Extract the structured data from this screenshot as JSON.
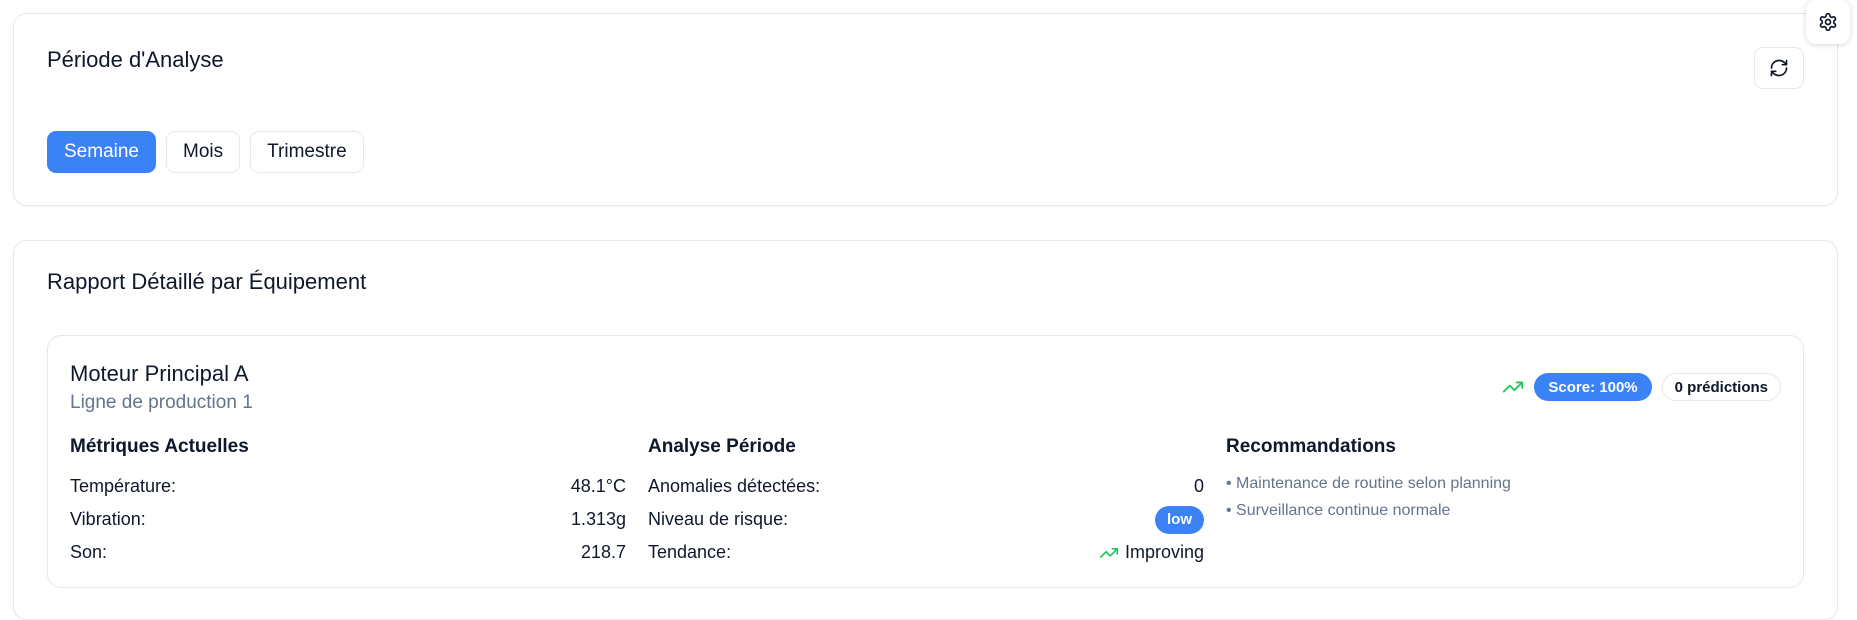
{
  "period": {
    "title": "Période d'Analyse",
    "options": [
      {
        "label": "Semaine",
        "active": true
      },
      {
        "label": "Mois",
        "active": false
      },
      {
        "label": "Trimestre",
        "active": false
      }
    ],
    "refresh_icon": "refresh-icon"
  },
  "report": {
    "title": "Rapport Détaillé par Équipement",
    "equipment": {
      "name": "Moteur Principal A",
      "line": "Ligne de production 1",
      "trend_icon": "trending-up-icon",
      "score": "Score: 100%",
      "predictions": "0 prédictions",
      "metrics": {
        "title": "Métriques Actuelles",
        "rows": [
          {
            "label": "Température:",
            "value": "48.1°C"
          },
          {
            "label": "Vibration:",
            "value": "1.313g"
          },
          {
            "label": "Son:",
            "value": "218.7"
          }
        ]
      },
      "analysis": {
        "title": "Analyse Période",
        "anomalies_label": "Anomalies détectées:",
        "anomalies_value": "0",
        "risk_label": "Niveau de risque:",
        "risk_value": "low",
        "trend_label": "Tendance:",
        "trend_value": "Improving"
      },
      "recommendations": {
        "title": "Recommandations",
        "items": [
          "• Maintenance de routine selon planning",
          "• Surveillance continue normale"
        ]
      }
    }
  },
  "settings_icon": "gear-icon",
  "colors": {
    "accent": "#3b82f6",
    "trend_green": "#22c55e",
    "muted_text": "#64748b"
  }
}
